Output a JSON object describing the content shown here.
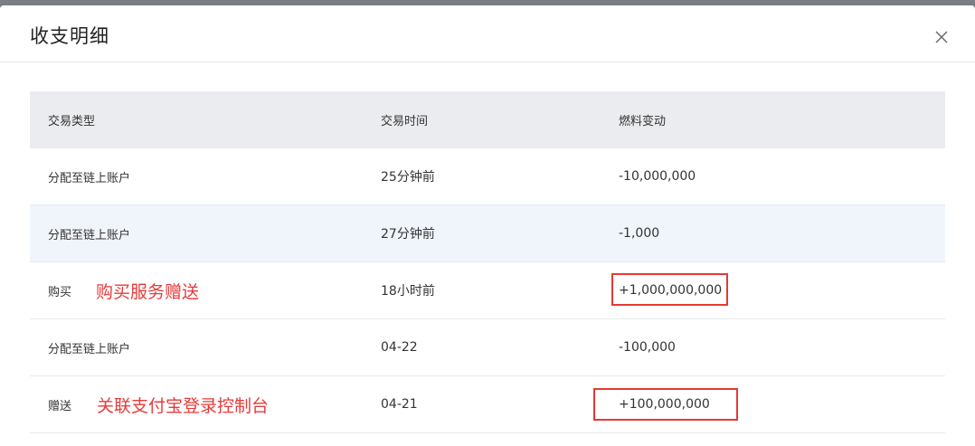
{
  "dialog": {
    "title": "收支明细",
    "close_icon": "close-icon"
  },
  "table": {
    "headers": [
      "交易类型",
      "交易时间",
      "燃料变动"
    ],
    "rows": [
      {
        "type": "分配至链上账户",
        "time": "25分钟前",
        "change": "-10,000,000"
      },
      {
        "type": "分配至链上账户",
        "time": "27分钟前",
        "change": "-1,000"
      },
      {
        "type": "购买",
        "time": "18小时前",
        "change": "+1,000,000,000",
        "annotation": "购买服务赠送"
      },
      {
        "type": "分配至链上账户",
        "time": "04-22",
        "change": "-100,000"
      },
      {
        "type": "赠送",
        "time": "04-21",
        "change": "+100,000,000",
        "annotation": "关联支付宝登录控制台"
      }
    ]
  },
  "colors": {
    "annotation": "#e83a3a",
    "header_bg": "#ebecef",
    "hover_row_bg": "#f0f5fc"
  }
}
